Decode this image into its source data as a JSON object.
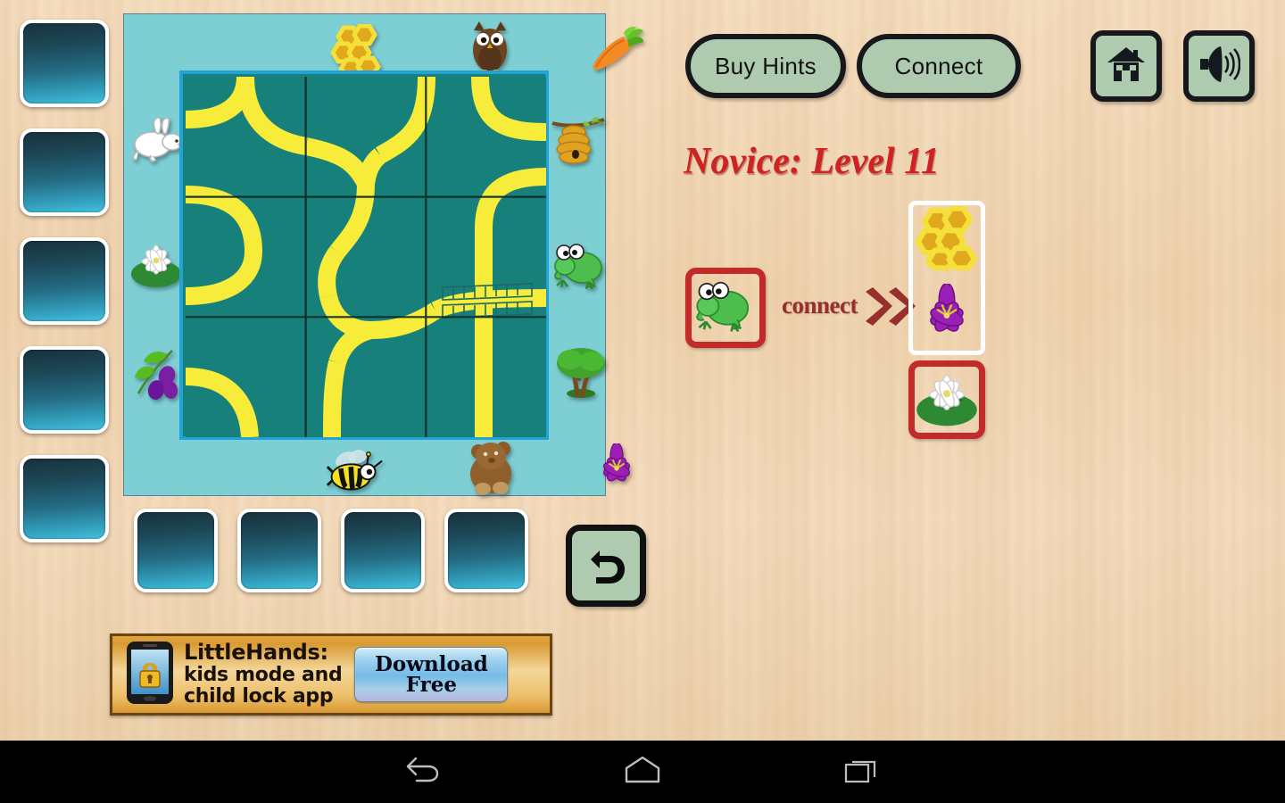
{
  "app": {
    "background_color": "#efd3ae",
    "board_bg": "#7ecfd4",
    "grid_bg": "#17807a",
    "path_color": "#f7ec3a",
    "accent_red": "#c32b2b",
    "button_face": "#aecbb0"
  },
  "toolbar": {
    "buy_hints_label": "Buy Hints",
    "connect_label": "Connect",
    "home_icon": "home-icon",
    "sound_icon": "speaker-icon"
  },
  "title": "Novice: Level 11",
  "connect_panel": {
    "connect_label": "connect",
    "chevron_icon": "double-chevron-right-icon",
    "source": {
      "icon": "frog-icon",
      "label": "Frog",
      "selected": true
    },
    "targets": [
      {
        "icon": "honeycomb-icon",
        "label": "Honeycomb",
        "selected": false
      },
      {
        "icon": "purple-flower-icon",
        "label": "Purple Flower",
        "selected": false
      },
      {
        "icon": "water-lily-icon",
        "label": "Water Lily",
        "selected": true
      }
    ]
  },
  "rail": {
    "count": 5,
    "items": [
      {
        "name": "rail-tile-1",
        "empty": true
      },
      {
        "name": "rail-tile-2",
        "empty": true
      },
      {
        "name": "rail-tile-3",
        "empty": true
      },
      {
        "name": "rail-tile-4",
        "empty": true
      },
      {
        "name": "rail-tile-5",
        "empty": true
      }
    ]
  },
  "tray": {
    "count": 4,
    "items": [
      {
        "name": "tray-tile-1",
        "empty": true
      },
      {
        "name": "tray-tile-2",
        "empty": true
      },
      {
        "name": "tray-tile-3",
        "empty": true
      },
      {
        "name": "tray-tile-4",
        "empty": true
      }
    ],
    "undo_icon": "undo-arrow-icon"
  },
  "board": {
    "rows": 3,
    "cols": 3,
    "edge_icons": {
      "top": [
        "honeycomb-icon",
        "owl-icon",
        "carrot-icon"
      ],
      "left": [
        "rabbit-icon",
        "water-lily-icon",
        "berries-icon"
      ],
      "right": [
        "beehive-icon",
        "frog-icon",
        "tree-icon"
      ],
      "bottom": [
        "bee-icon",
        "bear-icon",
        "purple-flower-icon"
      ]
    },
    "bridge": {
      "present": true,
      "cell": "middle-right"
    }
  },
  "ad": {
    "brand": "LittleHands:",
    "line2": "kids mode and",
    "line3": "child lock app",
    "cta_line1": "Download",
    "cta_line2": "Free",
    "phone_icon": "phone-lock-icon"
  },
  "android_nav": {
    "back_icon": "back-arrow-icon",
    "home_icon": "home-outline-icon",
    "recents_icon": "recents-icon"
  }
}
